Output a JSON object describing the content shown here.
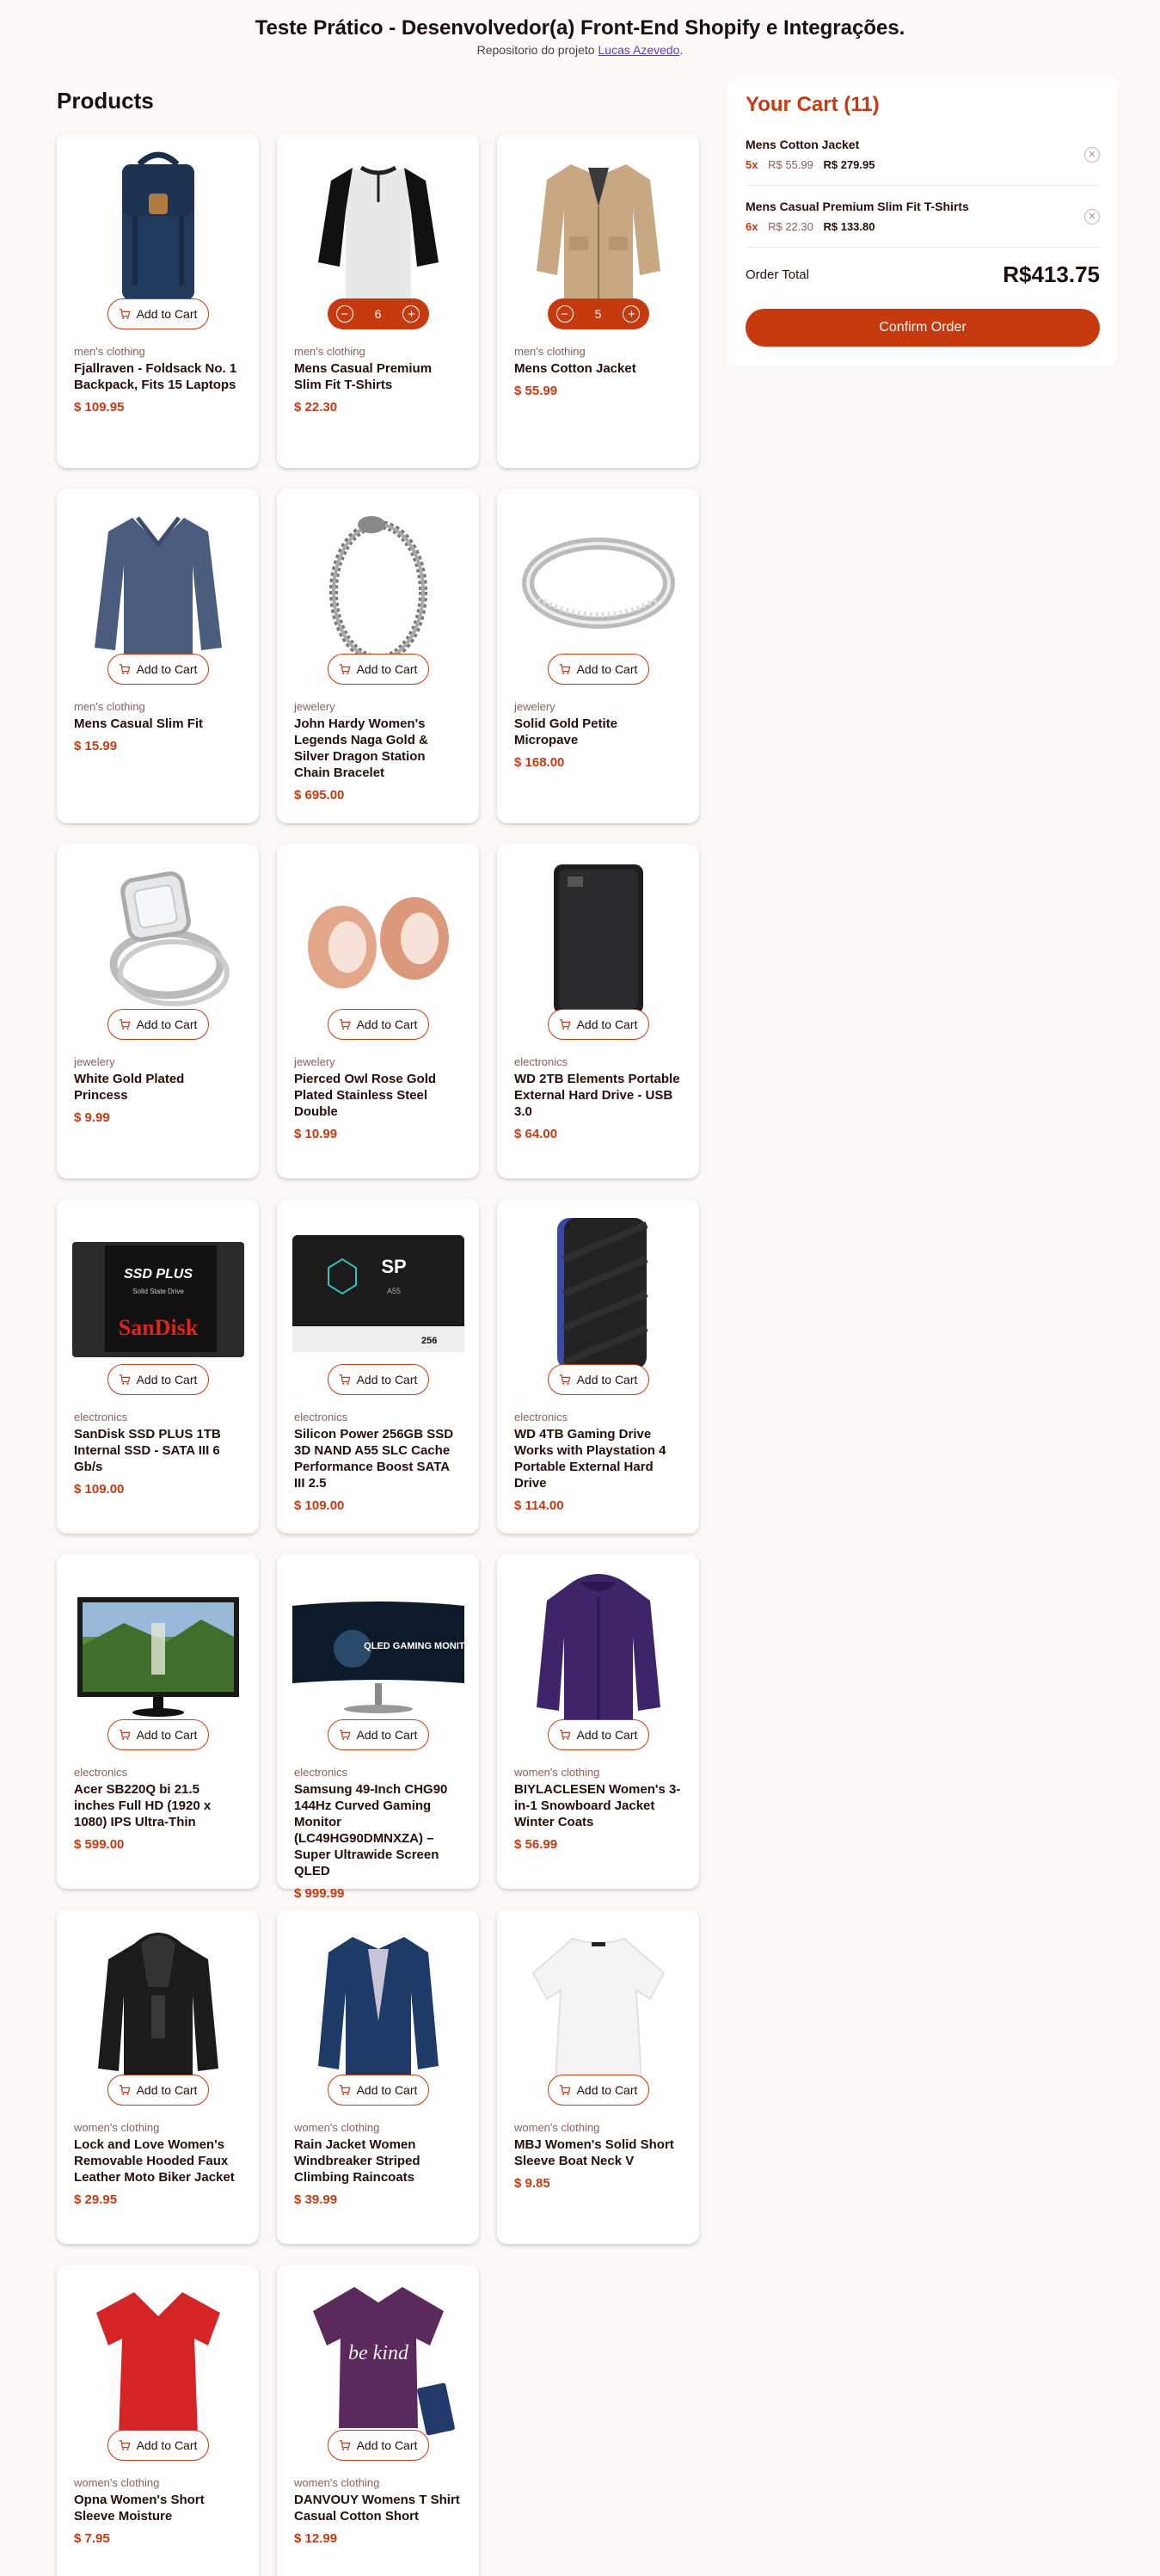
{
  "header": {
    "title": "Teste Prático - Desenvolvedor(a) Front-End Shopify e Integrações.",
    "subtitle_prefix": "Repositorio do projeto ",
    "subtitle_link": "Lucas Azevedo",
    "subtitle_suffix": "."
  },
  "products": {
    "title": "Products",
    "add_label": "Add to Cart",
    "items": [
      {
        "category": "men's clothing",
        "name": "Fjallraven - Foldsack No. 1 Backpack, Fits 15 Laptops",
        "price": "$ 109.95",
        "icon": "backpack"
      },
      {
        "category": "men's clothing",
        "name": "Mens Casual Premium Slim Fit T-Shirts",
        "price": "$ 22.30",
        "icon": "henley-shirt",
        "qty": "6"
      },
      {
        "category": "men's clothing",
        "name": "Mens Cotton Jacket",
        "price": "$ 55.99",
        "icon": "cotton-jacket",
        "qty": "5"
      },
      {
        "category": "men's clothing",
        "name": "Mens Casual Slim Fit",
        "price": "$ 15.99",
        "icon": "long-sleeve-shirt"
      },
      {
        "category": "jewelery",
        "name": "John Hardy Women's Legends Naga Gold & Silver Dragon Station Chain Bracelet",
        "price": "$ 695.00",
        "icon": "bracelet"
      },
      {
        "category": "jewelery",
        "name": "Solid Gold Petite Micropave",
        "price": "$ 168.00",
        "icon": "ring"
      },
      {
        "category": "jewelery",
        "name": "White Gold Plated Princess",
        "price": "$ 9.99",
        "icon": "diamond-ring"
      },
      {
        "category": "jewelery",
        "name": "Pierced Owl Rose Gold Plated Stainless Steel Double",
        "price": "$ 10.99",
        "icon": "rose-gold-plugs"
      },
      {
        "category": "electronics",
        "name": "WD 2TB Elements Portable External Hard Drive - USB 3.0",
        "price": "$ 64.00",
        "icon": "hard-drive"
      },
      {
        "category": "electronics",
        "name": "SanDisk SSD PLUS 1TB Internal SSD - SATA III 6 Gb/s",
        "price": "$ 109.00",
        "icon": "sandisk-ssd",
        "ssd_brand": "SanDisk",
        "ssd_model": "SSD PLUS",
        "ssd_sub": "Solid State Drive"
      },
      {
        "category": "electronics",
        "name": "Silicon Power 256GB SSD 3D NAND A55 SLC Cache Performance Boost SATA III 2.5",
        "price": "$ 109.00",
        "icon": "sp-ssd",
        "ssd_brand": "SP",
        "ssd_model": "A55",
        "ssd_cap": "256"
      },
      {
        "category": "electronics",
        "name": "WD 4TB Gaming Drive Works with Playstation 4 Portable External Hard Drive",
        "price": "$ 114.00",
        "icon": "gaming-drive"
      },
      {
        "category": "electronics",
        "name": "Acer SB220Q bi 21.5 inches Full HD (1920 x 1080) IPS Ultra-Thin",
        "price": "$ 599.00",
        "icon": "monitor"
      },
      {
        "category": "electronics",
        "name": "Samsung 49-Inch CHG90 144Hz Curved Gaming Monitor (LC49HG90DMNXZA) – Super Ultrawide Screen QLED",
        "price": "$ 999.99",
        "icon": "curved-monitor",
        "screen_text": "QLED GAMING MONITOR"
      },
      {
        "category": "women's clothing",
        "name": "BIYLACLESEN Women's 3-in-1 Snowboard Jacket Winter Coats",
        "price": "$ 56.99",
        "icon": "snow-jacket"
      },
      {
        "category": "women's clothing",
        "name": "Lock and Love Women's Removable Hooded Faux Leather Moto Biker Jacket",
        "price": "$ 29.95",
        "icon": "leather-jacket"
      },
      {
        "category": "women's clothing",
        "name": "Rain Jacket Women Windbreaker Striped Climbing Raincoats",
        "price": "$ 39.99",
        "icon": "rain-jacket"
      },
      {
        "category": "women's clothing",
        "name": "MBJ Women's Solid Short Sleeve Boat Neck V",
        "price": "$ 9.85",
        "icon": "white-top"
      },
      {
        "category": "women's clothing",
        "name": "Opna Women's Short Sleeve Moisture",
        "price": "$ 7.95",
        "icon": "red-tshirt"
      },
      {
        "category": "women's clothing",
        "name": "DANVOUY Womens T Shirt Casual Cotton Short",
        "price": "$ 12.99",
        "icon": "purple-tshirt",
        "shirt_text": "be kind"
      }
    ]
  },
  "cart": {
    "title": "Your Cart (11)",
    "items": [
      {
        "name": "Mens Cotton Jacket",
        "qty": "5x",
        "unit": "R$ 55.99",
        "total": "R$ 279.95"
      },
      {
        "name": "Mens Casual Premium Slim Fit T-Shirts",
        "qty": "6x",
        "unit": "R$ 22.30",
        "total": "R$ 133.80"
      }
    ],
    "total_label": "Order Total",
    "total_value": "R$413.75",
    "confirm_label": "Confirm Order"
  },
  "colors": {
    "accent": "#c73a0f",
    "background": "#fcf8f6",
    "text": "#260f08"
  }
}
